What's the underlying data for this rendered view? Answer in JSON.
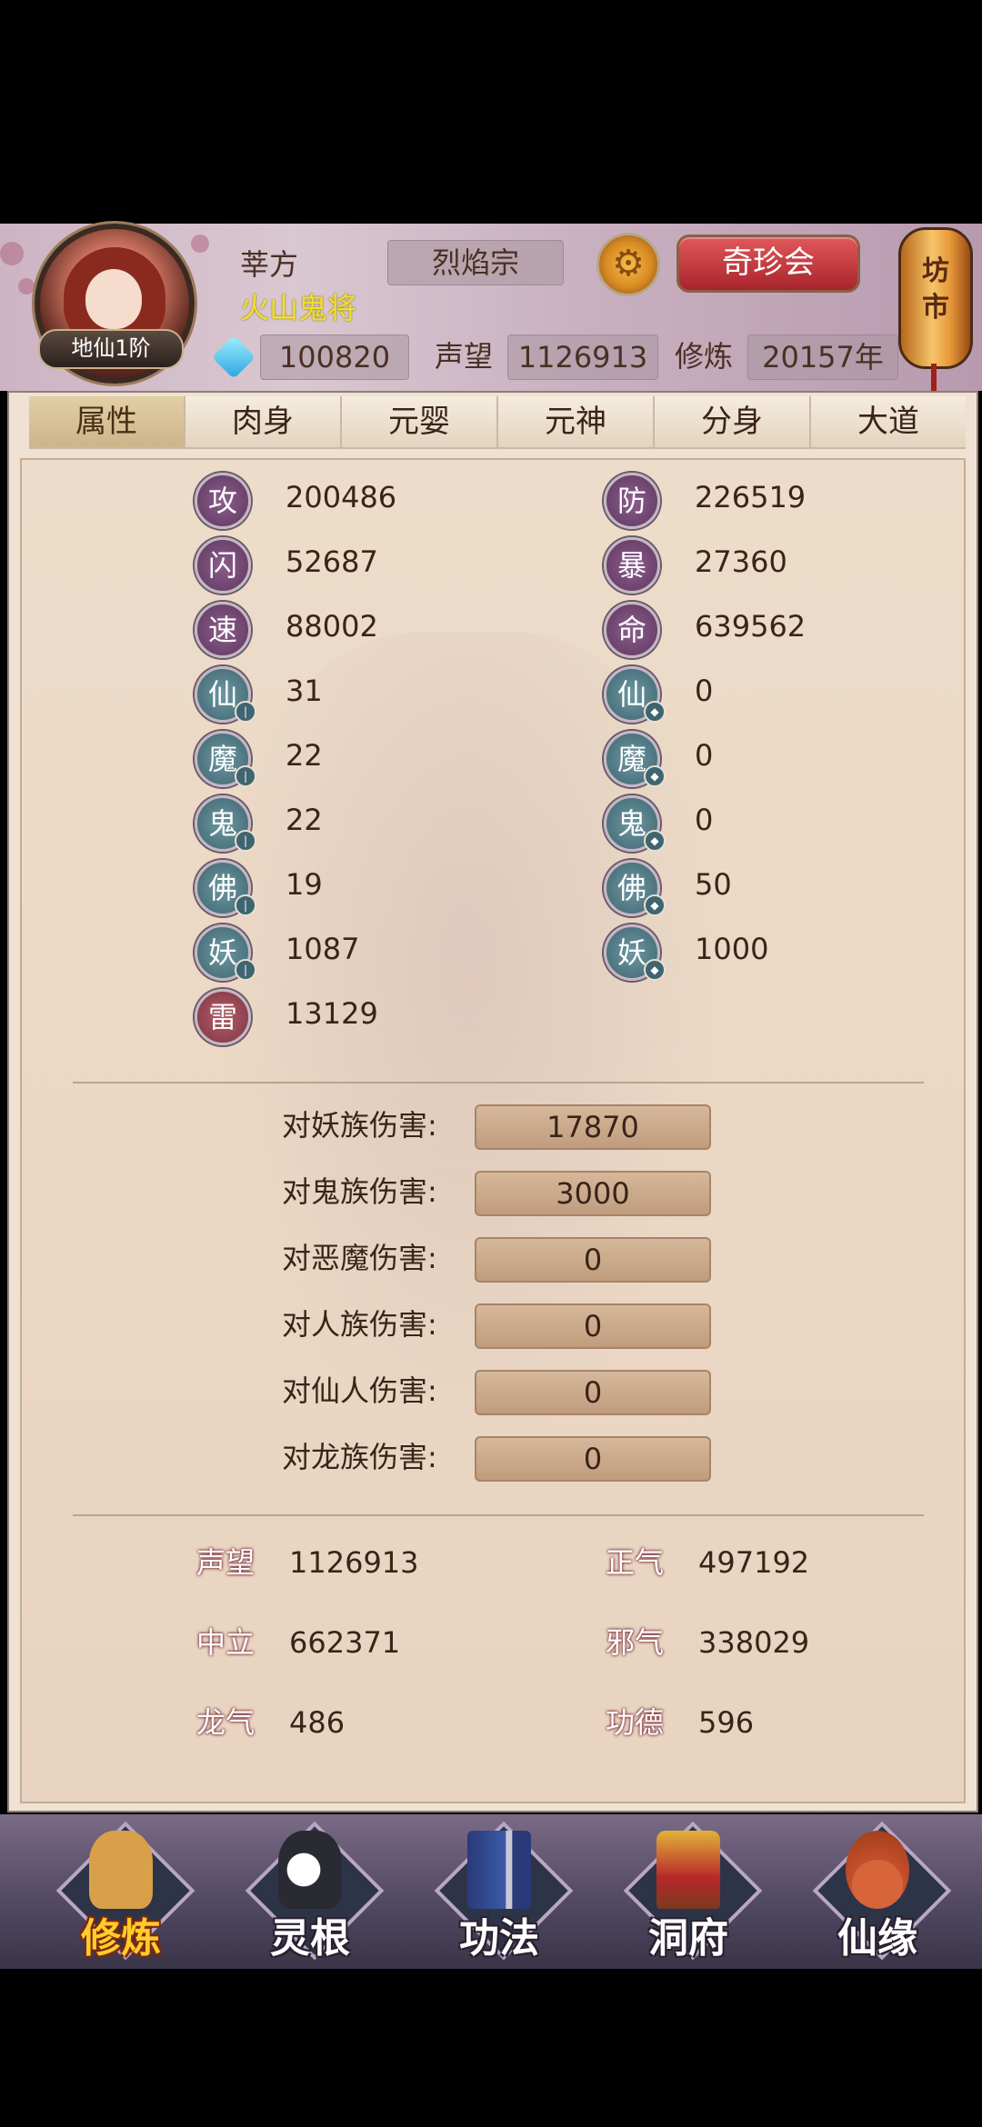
{
  "header": {
    "rank": "地仙1阶",
    "name": "莘方",
    "title": "火山鬼将",
    "sect": "烈焰宗",
    "treasure_button": "奇珍会",
    "market": "坊市",
    "gems": "100820",
    "reputation_label": "声望",
    "reputation": "1126913",
    "cultivation_label": "修炼",
    "cultivation": "20157年"
  },
  "tabs": [
    "属性",
    "肉身",
    "元婴",
    "元神",
    "分身",
    "大道"
  ],
  "attributes_left": [
    {
      "label": "攻",
      "value": "200486",
      "style": "purple"
    },
    {
      "label": "闪",
      "value": "52687",
      "style": "purple"
    },
    {
      "label": "速",
      "value": "88002",
      "style": "purple"
    },
    {
      "label": "仙",
      "value": "31",
      "style": "teal"
    },
    {
      "label": "魔",
      "value": "22",
      "style": "teal"
    },
    {
      "label": "鬼",
      "value": "22",
      "style": "teal"
    },
    {
      "label": "佛",
      "value": "19",
      "style": "teal"
    },
    {
      "label": "妖",
      "value": "1087",
      "style": "teal"
    },
    {
      "label": "雷",
      "value": "13129",
      "style": "red"
    }
  ],
  "attributes_right": [
    {
      "label": "防",
      "value": "226519",
      "style": "purple"
    },
    {
      "label": "暴",
      "value": "27360",
      "style": "purple"
    },
    {
      "label": "命",
      "value": "639562",
      "style": "purple"
    },
    {
      "label": "仙",
      "value": "0",
      "style": "teal"
    },
    {
      "label": "魔",
      "value": "0",
      "style": "teal"
    },
    {
      "label": "鬼",
      "value": "0",
      "style": "teal"
    },
    {
      "label": "佛",
      "value": "50",
      "style": "teal"
    },
    {
      "label": "妖",
      "value": "1000",
      "style": "teal"
    }
  ],
  "damage": [
    {
      "label": "对妖族伤害:",
      "value": "17870"
    },
    {
      "label": "对鬼族伤害:",
      "value": "3000"
    },
    {
      "label": "对恶魔伤害:",
      "value": "0"
    },
    {
      "label": "对人族伤害:",
      "value": "0"
    },
    {
      "label": "对仙人伤害:",
      "value": "0"
    },
    {
      "label": "对龙族伤害:",
      "value": "0"
    }
  ],
  "reputation_stats": [
    {
      "label": "声望",
      "value": "1126913"
    },
    {
      "label": "正气",
      "value": "497192"
    },
    {
      "label": "中立",
      "value": "662371"
    },
    {
      "label": "邪气",
      "value": "338029"
    },
    {
      "label": "龙气",
      "value": "486"
    },
    {
      "label": "功德",
      "value": "596"
    }
  ],
  "bottom_nav": [
    {
      "label": "修炼",
      "icon": "monk-icon",
      "color": "#d9a04a"
    },
    {
      "label": "灵根",
      "icon": "yin-yang-sword-icon",
      "color": "#3a3a44"
    },
    {
      "label": "功法",
      "icon": "book-icon",
      "color": "#3a5aa8"
    },
    {
      "label": "洞府",
      "icon": "pagoda-icon",
      "color": "#c99a2a"
    },
    {
      "label": "仙缘",
      "icon": "gourd-icon",
      "color": "#c4502a"
    }
  ],
  "colors": {
    "accent": "#f2e02a",
    "button": "#c8333a",
    "panel": "#efe2d4"
  }
}
